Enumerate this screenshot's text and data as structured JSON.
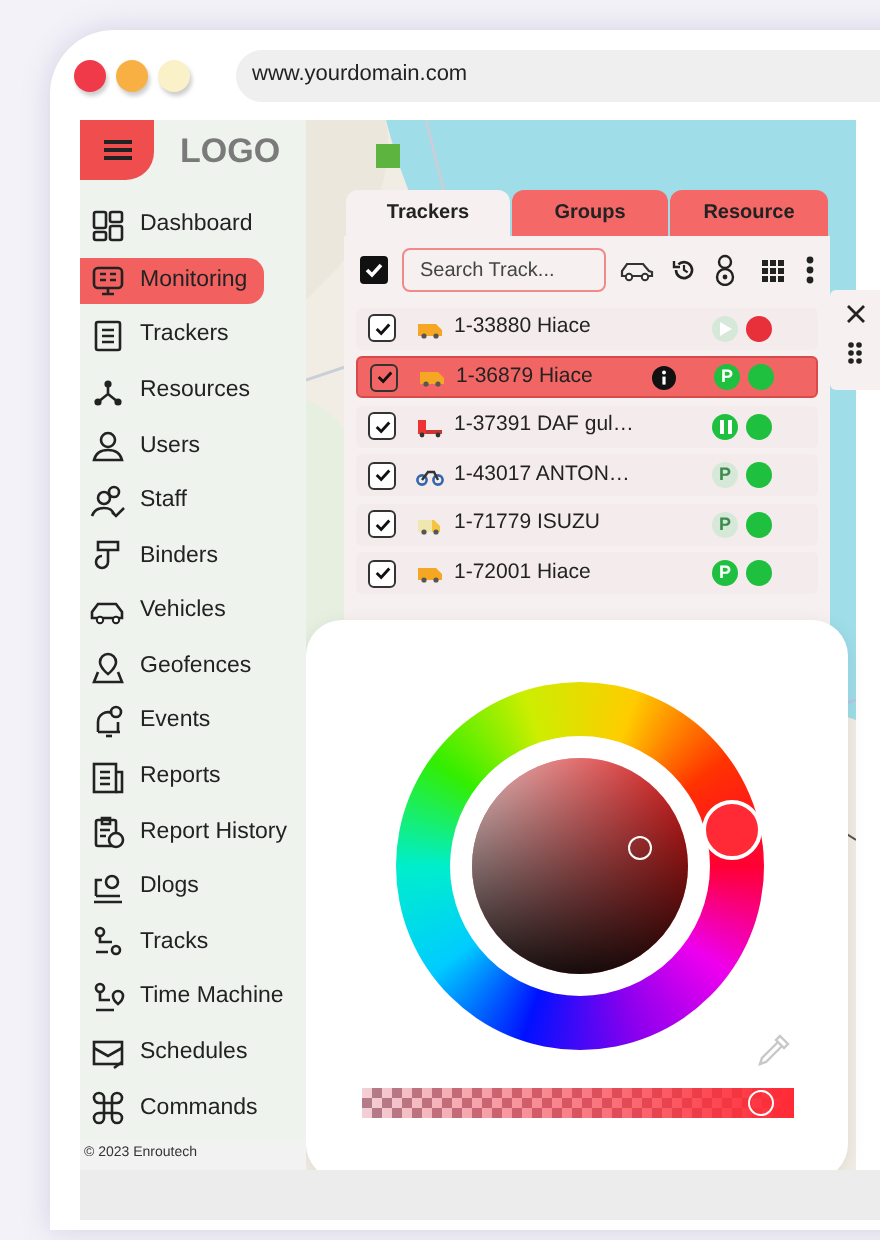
{
  "browser": {
    "url": "www.yourdomain.com"
  },
  "logo": "LOGO",
  "sidebar": {
    "items": [
      {
        "label": "Dashboard",
        "selected": false
      },
      {
        "label": "Monitoring",
        "selected": true
      },
      {
        "label": "Trackers",
        "selected": false
      },
      {
        "label": "Resources",
        "selected": false
      },
      {
        "label": "Users",
        "selected": false
      },
      {
        "label": "Staff",
        "selected": false
      },
      {
        "label": "Binders",
        "selected": false
      },
      {
        "label": "Vehicles",
        "selected": false
      },
      {
        "label": "Geofences",
        "selected": false
      },
      {
        "label": "Events",
        "selected": false
      },
      {
        "label": "Reports",
        "selected": false
      },
      {
        "label": "Report History",
        "selected": false
      },
      {
        "label": "Dlogs",
        "selected": false
      },
      {
        "label": "Tracks",
        "selected": false
      },
      {
        "label": "Time Machine",
        "selected": false
      },
      {
        "label": "Schedules",
        "selected": false
      },
      {
        "label": "Commands",
        "selected": false
      }
    ],
    "footer": "© 2023 Enroutech"
  },
  "tracker_panel": {
    "tabs": [
      {
        "label": "Trackers",
        "selected": true
      },
      {
        "label": "Groups",
        "selected": false
      },
      {
        "label": "Resource",
        "selected": false
      }
    ],
    "select_all": {
      "checked": true
    },
    "search": {
      "placeholder": "Search Track..."
    },
    "rows": [
      {
        "name": "1-33880 Hiace",
        "checked": true,
        "selected": false,
        "info": false,
        "badge": {
          "kind": "play",
          "active": false
        },
        "color": "#e8303a"
      },
      {
        "name": "1-36879 Hiace",
        "checked": true,
        "selected": true,
        "info": true,
        "badge": {
          "kind": "parking",
          "label": "P",
          "active": true
        },
        "color": "#1fbf3f"
      },
      {
        "name": "1-37391 DAF gul…",
        "checked": true,
        "selected": false,
        "info": false,
        "badge": {
          "kind": "pause",
          "active": true
        },
        "color": "#1fbf3f"
      },
      {
        "name": "1-43017 ANTON…",
        "checked": true,
        "selected": false,
        "info": false,
        "badge": {
          "kind": "parking",
          "label": "P",
          "active": false
        },
        "color": "#1fbf3f"
      },
      {
        "name": "1-71779 ISUZU",
        "checked": true,
        "selected": false,
        "info": false,
        "badge": {
          "kind": "parking",
          "label": "P",
          "active": false
        },
        "color": "#1fbf3f"
      },
      {
        "name": "1-72001 Hiace",
        "checked": true,
        "selected": false,
        "info": false,
        "badge": {
          "kind": "parking",
          "label": "P",
          "active": true
        },
        "color": "#1fbf3f"
      }
    ]
  },
  "color_picker": {
    "alpha": {
      "level": 0.92
    }
  }
}
